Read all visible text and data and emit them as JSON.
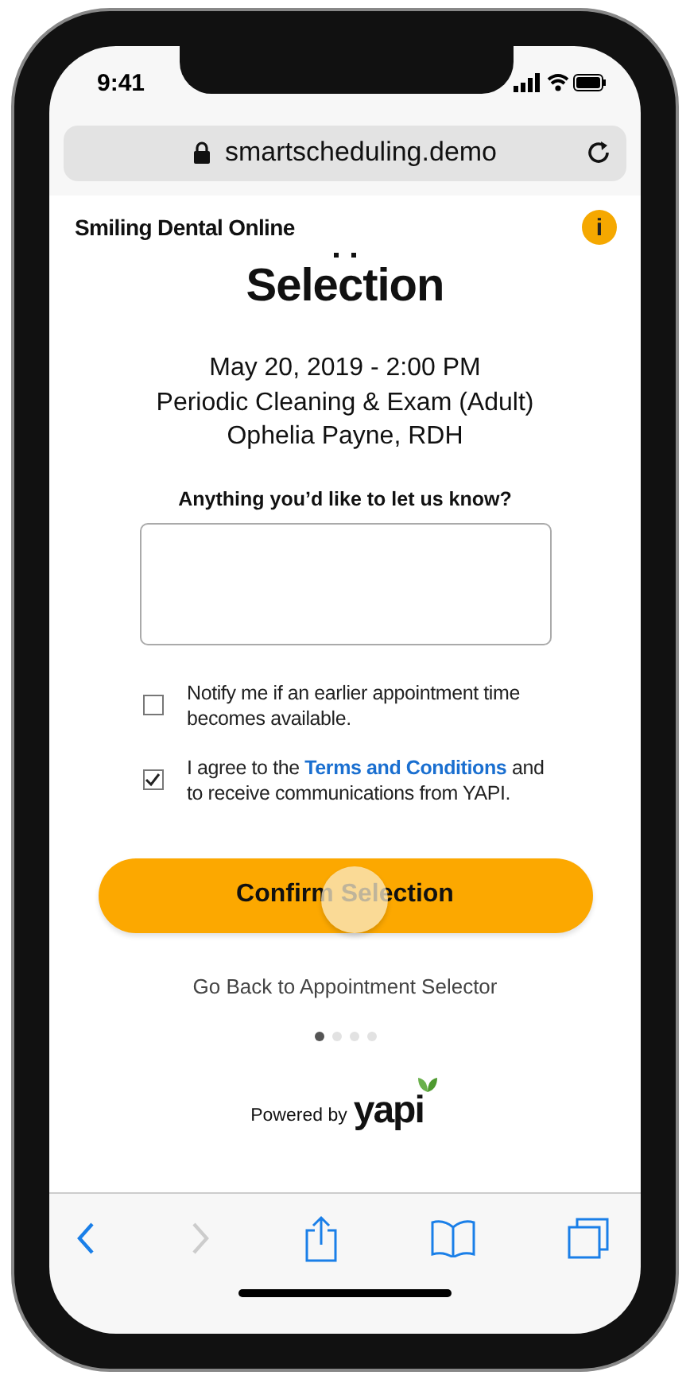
{
  "status_bar": {
    "time": "9:41"
  },
  "browser": {
    "url": "smartscheduling.demo",
    "back_disabled": false,
    "forward_disabled": true
  },
  "header": {
    "title": "Smiling Dental Online",
    "info_icon": "i"
  },
  "page": {
    "title": "Selection",
    "appointment": [
      "May 20, 2019 - 2:00 PM",
      "Periodic Cleaning & Exam (Adult)",
      "Ophelia Payne, RDH"
    ],
    "notes": {
      "label": "Anything you’d like to let us know?"
    },
    "options": [
      {
        "text": "Notify me if an earlier appointment time becomes available.",
        "checked": false
      },
      {
        "text": "I agree to the **Terms and Conditions** and to receive communications from YAPI.",
        "checked": true
      }
    ],
    "confirm_button": "Confirm Selection",
    "back_link": "Go Back to Appointment Selector",
    "steps": [
      {
        "selected": true
      },
      {
        "selected": false
      },
      {
        "selected": false
      },
      {
        "selected": false
      }
    ],
    "powered_by": "Powered by",
    "brand": "yapi"
  }
}
